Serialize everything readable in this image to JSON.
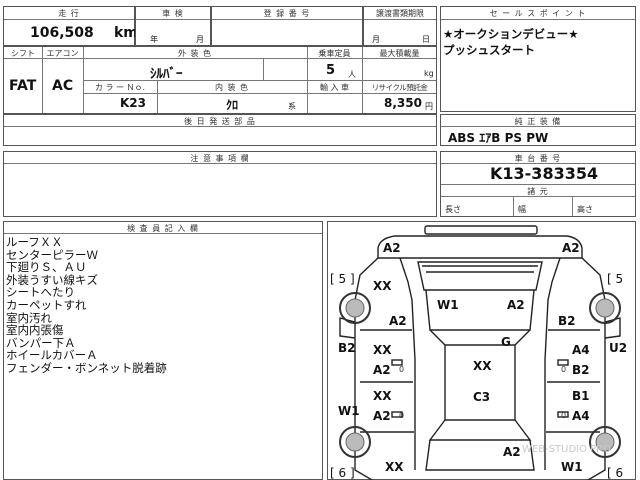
{
  "header": {
    "mileage_label": "走 行",
    "mileage_value": "106,508",
    "mileage_unit": "km",
    "shaken_label": "車 検",
    "shaken_year": "年",
    "shaken_month": "月",
    "reg_label": "登 録 番 号",
    "transfer_label": "譲渡書類期限",
    "transfer_month": "月",
    "transfer_day": "日"
  },
  "specs": {
    "shift_label": "シフト",
    "shift_value": "FAT",
    "aircon_label": "エアコン",
    "aircon_value": "AC",
    "exterior_label": "外 装 色",
    "exterior_value": "ｼﾙﾊﾞｰ",
    "capacity_label": "乗車定員",
    "capacity_value": "5",
    "capacity_unit": "人",
    "load_label": "最大積載量",
    "load_unit": "kg",
    "color_no_label": "カ ラ ー Ｎｏ.",
    "color_no_value": "K23",
    "interior_label": "内 装 色",
    "interior_value": "ｸﾛ",
    "interior_unit": "系",
    "import_label": "輸 入 車",
    "recycle_label": "リサイクル預託金",
    "recycle_value": "8,350",
    "recycle_unit": "円",
    "later_docs_label": "後 日 発 送 部 品"
  },
  "sales_point": {
    "label": "セ ー ル ス ポ イ ン ト",
    "line1": "★オークションデビュー★",
    "line2": "プッシュスタート"
  },
  "equipment": {
    "label": "純 正 装 備",
    "value": "ABS ｴｱB PS PW"
  },
  "caution": {
    "label": "注 意 事 項 欄"
  },
  "chassis": {
    "label": "車 台 番 号",
    "value": "K13-383354",
    "dims_label": "諸 元",
    "length_label": "長さ",
    "width_label": "幅",
    "height_label": "高さ"
  },
  "inspector": {
    "label": "検 査 員 記 入 欄",
    "notes": [
      "ルーフＸＸ",
      "センターピラーＷ",
      "下廻りＳ、ＡＵ",
      "外装うすい線キズ",
      "シートへたり",
      "カーペットすれ",
      "室内汚れ",
      "室内内張傷",
      "バンパー下Ａ",
      "ホイールカバーＡ",
      "フェンダー・ボンネット脱着跡"
    ]
  },
  "diagram": {
    "tire_front_left": "[ 5 ]",
    "tire_front_right": "[ 5",
    "tire_rear_left": "[ 6 ]",
    "tire_rear_right": "[ 6",
    "codes": {
      "front_bumper_left": "A2",
      "front_bumper_right": "A2",
      "front_fender_left": "XX",
      "front_fender_left_lower": "A2",
      "hood_left": "W1",
      "hood_right": "A2",
      "front_fender_right": "B2",
      "roof": "G",
      "front_pillar_left": "B2",
      "front_door_left": "XX",
      "front_door_left_lower": "A2",
      "center_left": "XX",
      "front_door_right": "A4",
      "front_door_right_lower": "B2",
      "right_edge": "U2",
      "rear_door_left": "XX",
      "rear_door_left_lower": "A2",
      "trunk": "C3",
      "rear_door_right": "B1",
      "rear_door_right_lower": "A4",
      "rear_pillar_left": "W1",
      "rear_quarter_left": "XX",
      "rear_bumper_center": "A2",
      "rear_quarter_right": "W1"
    },
    "zero_marks": [
      "0",
      "0",
      "0",
      "0"
    ],
    "watermark": "WEB-STUDIO PRO"
  }
}
